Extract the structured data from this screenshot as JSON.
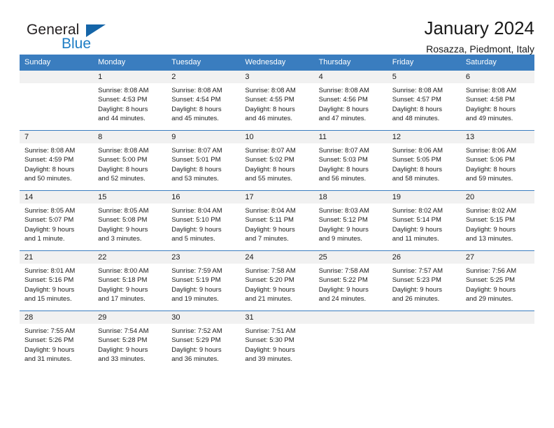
{
  "brand": {
    "name_part1": "General",
    "name_part2": "Blue",
    "flag_icon": "triangle-flag-icon"
  },
  "header": {
    "title": "January 2024",
    "subtitle": "Rosazza, Piedmont, Italy"
  },
  "colors": {
    "header_blue": "#3a7dbf",
    "brand_blue": "#1d7dc4",
    "flag_blue": "#1565a8",
    "daynum_band": "#f1f1f1",
    "text": "#1a1a1a"
  },
  "calendar": {
    "weekday_headers": [
      "Sunday",
      "Monday",
      "Tuesday",
      "Wednesday",
      "Thursday",
      "Friday",
      "Saturday"
    ],
    "weeks": [
      [
        {
          "day": "",
          "lines": []
        },
        {
          "day": "1",
          "lines": [
            "Sunrise: 8:08 AM",
            "Sunset: 4:53 PM",
            "Daylight: 8 hours",
            "and 44 minutes."
          ]
        },
        {
          "day": "2",
          "lines": [
            "Sunrise: 8:08 AM",
            "Sunset: 4:54 PM",
            "Daylight: 8 hours",
            "and 45 minutes."
          ]
        },
        {
          "day": "3",
          "lines": [
            "Sunrise: 8:08 AM",
            "Sunset: 4:55 PM",
            "Daylight: 8 hours",
            "and 46 minutes."
          ]
        },
        {
          "day": "4",
          "lines": [
            "Sunrise: 8:08 AM",
            "Sunset: 4:56 PM",
            "Daylight: 8 hours",
            "and 47 minutes."
          ]
        },
        {
          "day": "5",
          "lines": [
            "Sunrise: 8:08 AM",
            "Sunset: 4:57 PM",
            "Daylight: 8 hours",
            "and 48 minutes."
          ]
        },
        {
          "day": "6",
          "lines": [
            "Sunrise: 8:08 AM",
            "Sunset: 4:58 PM",
            "Daylight: 8 hours",
            "and 49 minutes."
          ]
        }
      ],
      [
        {
          "day": "7",
          "lines": [
            "Sunrise: 8:08 AM",
            "Sunset: 4:59 PM",
            "Daylight: 8 hours",
            "and 50 minutes."
          ]
        },
        {
          "day": "8",
          "lines": [
            "Sunrise: 8:08 AM",
            "Sunset: 5:00 PM",
            "Daylight: 8 hours",
            "and 52 minutes."
          ]
        },
        {
          "day": "9",
          "lines": [
            "Sunrise: 8:07 AM",
            "Sunset: 5:01 PM",
            "Daylight: 8 hours",
            "and 53 minutes."
          ]
        },
        {
          "day": "10",
          "lines": [
            "Sunrise: 8:07 AM",
            "Sunset: 5:02 PM",
            "Daylight: 8 hours",
            "and 55 minutes."
          ]
        },
        {
          "day": "11",
          "lines": [
            "Sunrise: 8:07 AM",
            "Sunset: 5:03 PM",
            "Daylight: 8 hours",
            "and 56 minutes."
          ]
        },
        {
          "day": "12",
          "lines": [
            "Sunrise: 8:06 AM",
            "Sunset: 5:05 PM",
            "Daylight: 8 hours",
            "and 58 minutes."
          ]
        },
        {
          "day": "13",
          "lines": [
            "Sunrise: 8:06 AM",
            "Sunset: 5:06 PM",
            "Daylight: 8 hours",
            "and 59 minutes."
          ]
        }
      ],
      [
        {
          "day": "14",
          "lines": [
            "Sunrise: 8:05 AM",
            "Sunset: 5:07 PM",
            "Daylight: 9 hours",
            "and 1 minute."
          ]
        },
        {
          "day": "15",
          "lines": [
            "Sunrise: 8:05 AM",
            "Sunset: 5:08 PM",
            "Daylight: 9 hours",
            "and 3 minutes."
          ]
        },
        {
          "day": "16",
          "lines": [
            "Sunrise: 8:04 AM",
            "Sunset: 5:10 PM",
            "Daylight: 9 hours",
            "and 5 minutes."
          ]
        },
        {
          "day": "17",
          "lines": [
            "Sunrise: 8:04 AM",
            "Sunset: 5:11 PM",
            "Daylight: 9 hours",
            "and 7 minutes."
          ]
        },
        {
          "day": "18",
          "lines": [
            "Sunrise: 8:03 AM",
            "Sunset: 5:12 PM",
            "Daylight: 9 hours",
            "and 9 minutes."
          ]
        },
        {
          "day": "19",
          "lines": [
            "Sunrise: 8:02 AM",
            "Sunset: 5:14 PM",
            "Daylight: 9 hours",
            "and 11 minutes."
          ]
        },
        {
          "day": "20",
          "lines": [
            "Sunrise: 8:02 AM",
            "Sunset: 5:15 PM",
            "Daylight: 9 hours",
            "and 13 minutes."
          ]
        }
      ],
      [
        {
          "day": "21",
          "lines": [
            "Sunrise: 8:01 AM",
            "Sunset: 5:16 PM",
            "Daylight: 9 hours",
            "and 15 minutes."
          ]
        },
        {
          "day": "22",
          "lines": [
            "Sunrise: 8:00 AM",
            "Sunset: 5:18 PM",
            "Daylight: 9 hours",
            "and 17 minutes."
          ]
        },
        {
          "day": "23",
          "lines": [
            "Sunrise: 7:59 AM",
            "Sunset: 5:19 PM",
            "Daylight: 9 hours",
            "and 19 minutes."
          ]
        },
        {
          "day": "24",
          "lines": [
            "Sunrise: 7:58 AM",
            "Sunset: 5:20 PM",
            "Daylight: 9 hours",
            "and 21 minutes."
          ]
        },
        {
          "day": "25",
          "lines": [
            "Sunrise: 7:58 AM",
            "Sunset: 5:22 PM",
            "Daylight: 9 hours",
            "and 24 minutes."
          ]
        },
        {
          "day": "26",
          "lines": [
            "Sunrise: 7:57 AM",
            "Sunset: 5:23 PM",
            "Daylight: 9 hours",
            "and 26 minutes."
          ]
        },
        {
          "day": "27",
          "lines": [
            "Sunrise: 7:56 AM",
            "Sunset: 5:25 PM",
            "Daylight: 9 hours",
            "and 29 minutes."
          ]
        }
      ],
      [
        {
          "day": "28",
          "lines": [
            "Sunrise: 7:55 AM",
            "Sunset: 5:26 PM",
            "Daylight: 9 hours",
            "and 31 minutes."
          ]
        },
        {
          "day": "29",
          "lines": [
            "Sunrise: 7:54 AM",
            "Sunset: 5:28 PM",
            "Daylight: 9 hours",
            "and 33 minutes."
          ]
        },
        {
          "day": "30",
          "lines": [
            "Sunrise: 7:52 AM",
            "Sunset: 5:29 PM",
            "Daylight: 9 hours",
            "and 36 minutes."
          ]
        },
        {
          "day": "31",
          "lines": [
            "Sunrise: 7:51 AM",
            "Sunset: 5:30 PM",
            "Daylight: 9 hours",
            "and 39 minutes."
          ]
        },
        {
          "day": "",
          "lines": []
        },
        {
          "day": "",
          "lines": []
        },
        {
          "day": "",
          "lines": []
        }
      ]
    ]
  }
}
